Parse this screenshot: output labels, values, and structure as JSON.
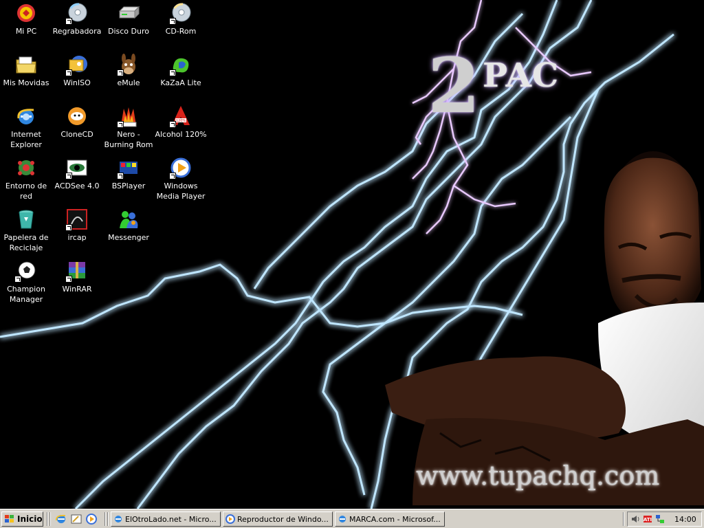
{
  "desktop": {
    "brand_number": "2",
    "brand_word": "PAC",
    "wallpaper_url": "www.tupachq.com",
    "icons": [
      {
        "label": "Mi PC",
        "icon": "my-computer-icon"
      },
      {
        "label": "Regrabadora",
        "icon": "cd-writer-icon"
      },
      {
        "label": "Disco Duro",
        "icon": "hard-disk-icon"
      },
      {
        "label": "CD-Rom",
        "icon": "cd-rom-icon"
      },
      {
        "label": "Mis Movidas",
        "icon": "folder-icon"
      },
      {
        "label": "WinISO",
        "icon": "winiso-icon"
      },
      {
        "label": "eMule",
        "icon": "emule-icon"
      },
      {
        "label": "KaZaA Lite",
        "icon": "kazaa-icon"
      },
      {
        "label": "Internet Explorer",
        "icon": "internet-explorer-icon"
      },
      {
        "label": "CloneCD",
        "icon": "clonecd-icon"
      },
      {
        "label": "Nero - Burning Rom",
        "icon": "nero-icon"
      },
      {
        "label": "Alcohol 120%",
        "icon": "alcohol-icon"
      },
      {
        "label": "Entorno de red",
        "icon": "network-icon"
      },
      {
        "label": "ACDSee 4.0",
        "icon": "acdsee-icon"
      },
      {
        "label": "BSPlayer",
        "icon": "bsplayer-icon"
      },
      {
        "label": "Windows Media Player",
        "icon": "media-player-icon"
      },
      {
        "label": "Papelera de Reciclaje",
        "icon": "recycle-bin-icon"
      },
      {
        "label": "ircap",
        "icon": "ircap-icon"
      },
      {
        "label": "Messenger",
        "icon": "messenger-icon"
      },
      {
        "label": "Champion Manager",
        "icon": "soccer-ball-icon"
      },
      {
        "label": "WinRAR",
        "icon": "winrar-icon"
      }
    ]
  },
  "taskbar": {
    "start_label": "Inicio",
    "quick_launch": [
      "internet-explorer-icon",
      "show-desktop-icon",
      "media-player-icon"
    ],
    "tasks": [
      {
        "label": "ElOtroLado.net - Micro...",
        "icon": "internet-explorer-icon"
      },
      {
        "label": "Reproductor de Windo...",
        "icon": "media-player-icon"
      },
      {
        "label": "MARCA.com - Microsof...",
        "icon": "internet-explorer-icon"
      }
    ],
    "tray": {
      "icons": [
        "volume-icon",
        "ati-icon",
        "network-tray-icon"
      ],
      "clock": "14:00"
    }
  }
}
